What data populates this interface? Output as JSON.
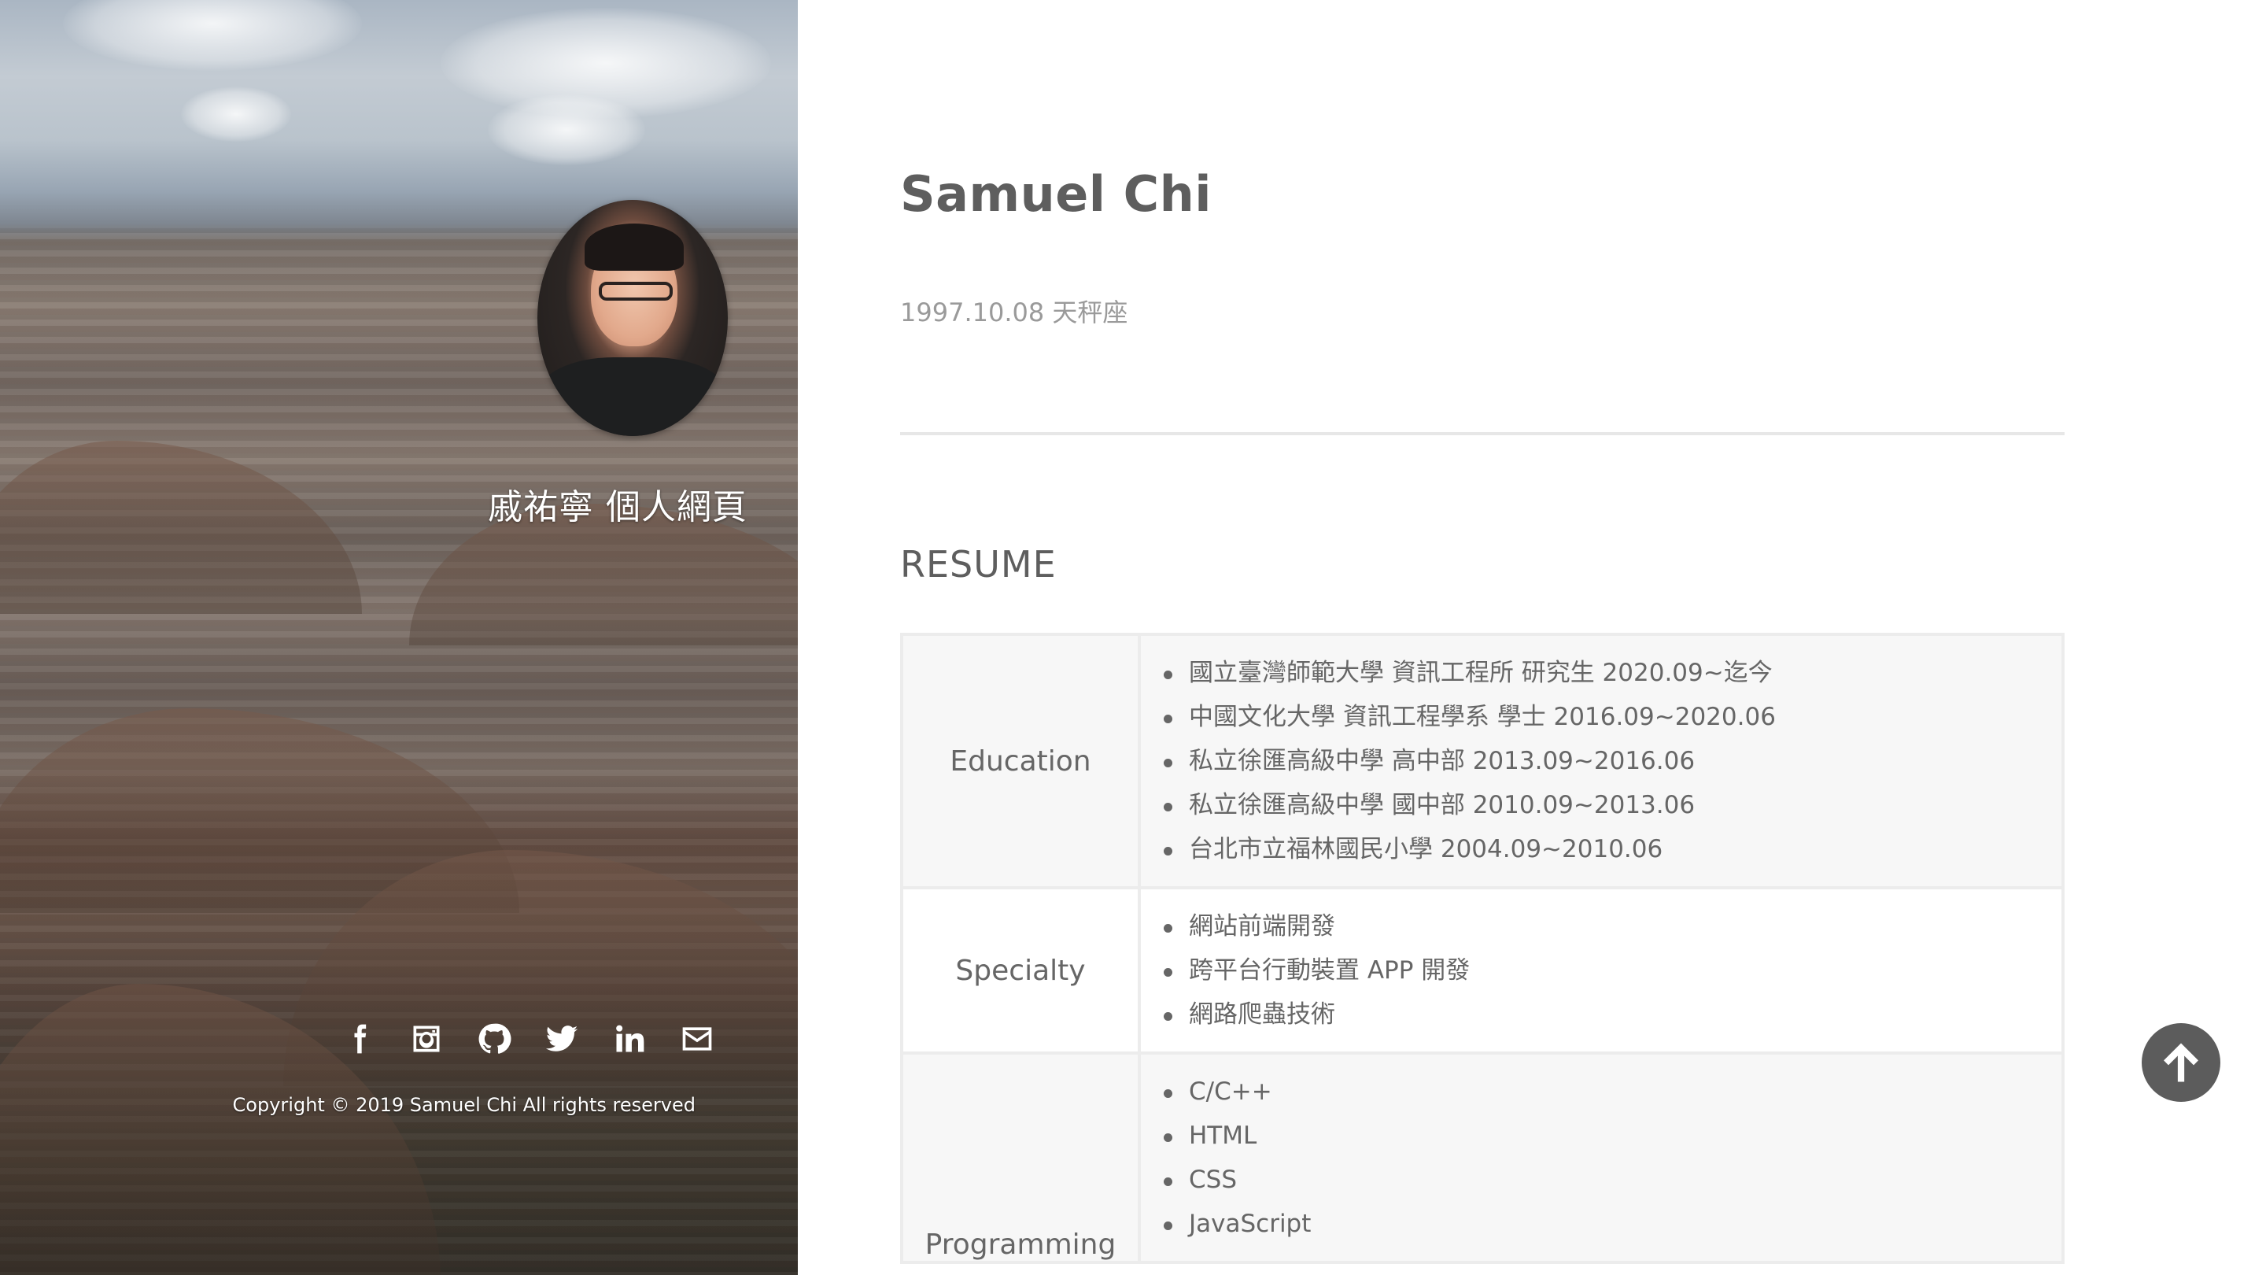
{
  "sidebar": {
    "site_title": "戚祐寧 個人網頁",
    "social_icons": [
      "facebook-icon",
      "instagram-icon",
      "github-icon",
      "twitter-icon",
      "linkedin-icon",
      "mail-icon"
    ],
    "copyright": "Copyright © 2019 Samuel Chi All rights reserved"
  },
  "main": {
    "name": "Samuel Chi",
    "birth": "1997.10.08 天秤座",
    "resume_title": "RESUME",
    "resume": [
      {
        "category": "Education",
        "items": [
          "國立臺灣師範大學 資訊工程所 研究生 2020.09~迄今",
          "中國文化大學 資訊工程學系 學士 2016.09~2020.06",
          "私立徐匯高級中學 高中部 2013.09~2016.06",
          "私立徐匯高級中學 國中部 2010.09~2013.06",
          "台北市立福林國民小學 2004.09~2010.06"
        ]
      },
      {
        "category": "Specialty",
        "items": [
          "網站前端開發",
          "跨平台行動裝置 APP 開發",
          "網路爬蟲技術"
        ]
      },
      {
        "category": "Programming",
        "items": [
          "C/C++",
          "HTML",
          "CSS",
          "JavaScript"
        ]
      }
    ]
  },
  "back_to_top": {
    "icon": "arrow-up-icon"
  },
  "colors": {
    "text": "#5e5e5e",
    "muted": "#9a9a9a",
    "border": "#ececec",
    "row_alt": "#f7f7f7",
    "to_top_button": "#5c5c5c"
  }
}
